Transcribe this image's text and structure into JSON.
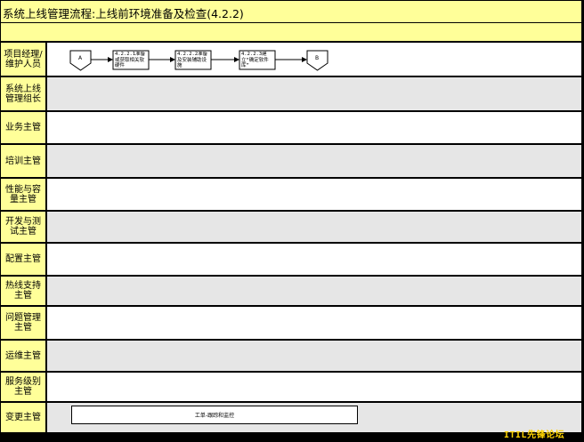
{
  "title": "系统上线管理流程:上线前环境准备及检查(4.2.2)",
  "lanes": [
    {
      "label": "项目经理/维护人员",
      "shade": "white"
    },
    {
      "label": "系统上线管理组长",
      "shade": "gray"
    },
    {
      "label": "业务主管",
      "shade": "white"
    },
    {
      "label": "培训主管",
      "shade": "gray"
    },
    {
      "label": "性能与容量主管",
      "shade": "white"
    },
    {
      "label": "开发与测试主管",
      "shade": "gray"
    },
    {
      "label": "配置主管",
      "shade": "white"
    },
    {
      "label": "热线支持主管",
      "shade": "gray"
    },
    {
      "label": "问题管理主管",
      "shade": "white"
    },
    {
      "label": "运维主管",
      "shade": "gray"
    },
    {
      "label": "服务级别主管",
      "shade": "white"
    },
    {
      "label": "变更主管",
      "shade": "gray"
    }
  ],
  "flow": {
    "start_connector": "A",
    "end_connector": "B",
    "steps": [
      {
        "id": "4.2.2.1",
        "text": "4.2.2.1准备或获取相关软硬件"
      },
      {
        "id": "4.2.2.2",
        "text": "4.2.2.2准备及安装辅助设施"
      },
      {
        "id": "4.2.2.3",
        "text": "4.2.2.3建立“确定软件库”"
      }
    ]
  },
  "ticket_box": "工单-跟踪和监控",
  "watermark": "ITIL先锋论坛"
}
